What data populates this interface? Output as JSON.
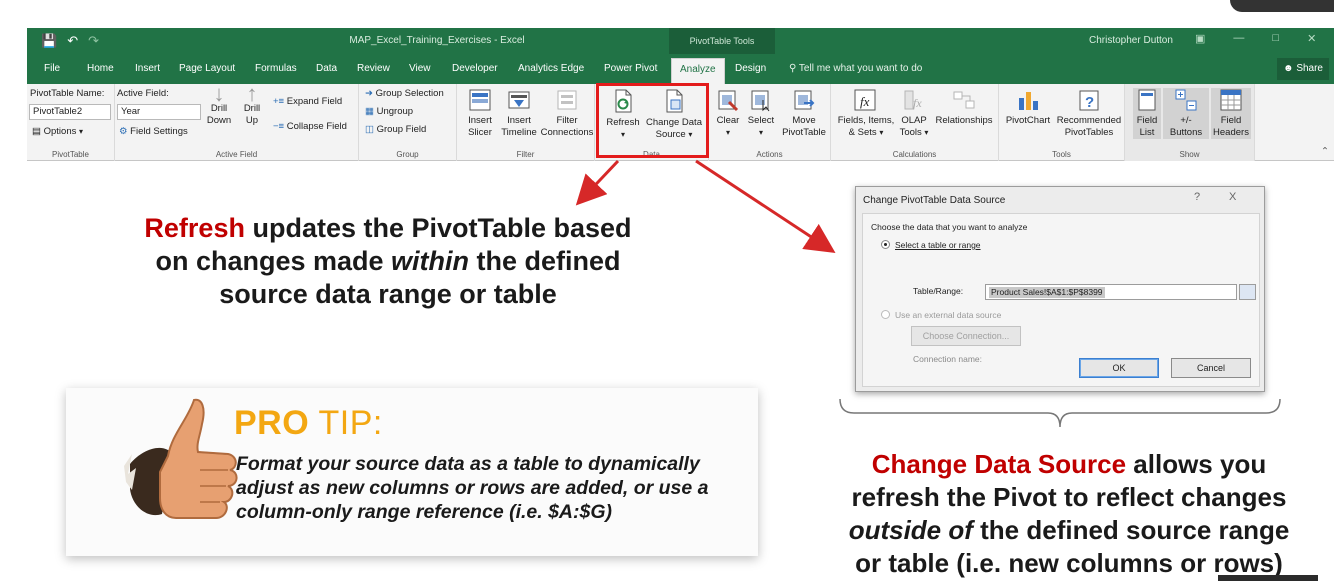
{
  "window": {
    "title": "MAP_Excel_Training_Exercises - Excel",
    "context_tools": "PivotTable Tools",
    "user": "Christopher Dutton"
  },
  "tabs": [
    "File",
    "Home",
    "Insert",
    "Page Layout",
    "Formulas",
    "Data",
    "Review",
    "View",
    "Developer",
    "Analytics Edge",
    "Power Pivot",
    "Analyze",
    "Design"
  ],
  "active_tab": "Analyze",
  "tell_me": "Tell me what you want to do",
  "share": "Share",
  "ribbon": {
    "pivottable": {
      "name_label": "PivotTable Name:",
      "name_value": "PivotTable2",
      "options": "Options",
      "group": "PivotTable"
    },
    "active_field": {
      "label": "Active Field:",
      "value": "Year",
      "field_settings": "Field Settings",
      "drill_down": [
        "Drill",
        "Down"
      ],
      "drill_up": [
        "Drill",
        "Up"
      ],
      "expand": "Expand Field",
      "collapse": "Collapse Field",
      "group": "Active Field"
    },
    "group_grp": {
      "group_selection": "Group Selection",
      "ungroup": "Ungroup",
      "group_field": "Group Field",
      "group": "Group"
    },
    "filter": {
      "insert_slicer": [
        "Insert",
        "Slicer"
      ],
      "insert_timeline": [
        "Insert",
        "Timeline"
      ],
      "filter_connections": [
        "Filter",
        "Connections"
      ],
      "group": "Filter"
    },
    "data": {
      "refresh": "Refresh",
      "change_source": [
        "Change Data",
        "Source"
      ],
      "group": "Data"
    },
    "actions": {
      "clear": "Clear",
      "select": "Select",
      "move": [
        "Move",
        "PivotTable"
      ],
      "group": "Actions"
    },
    "calculations": {
      "fields_items": [
        "Fields, Items,",
        "& Sets"
      ],
      "olap": [
        "OLAP",
        "Tools"
      ],
      "relationships": "Relationships",
      "group": "Calculations"
    },
    "tools": {
      "pivotchart": "PivotChart",
      "recommended": [
        "Recommended",
        "PivotTables"
      ],
      "group": "Tools"
    },
    "show": {
      "field_list": [
        "Field",
        "List"
      ],
      "buttons": [
        "+/-",
        "Buttons"
      ],
      "headers": [
        "Field",
        "Headers"
      ],
      "group": "Show"
    }
  },
  "refresh_note": {
    "keyword": "Refresh",
    "line1_rest": " updates the PivotTable based",
    "line2_a": "on changes made ",
    "line2_em": "within",
    "line2_b": " the defined",
    "line3": "source data range or table"
  },
  "pro_tip": {
    "pro": "PRO",
    "tip": " TIP:",
    "body": "Format your source data as a table to dynamically adjust as new columns or rows are added, or use a column-only range reference (i.e. $A:$G)"
  },
  "dialog": {
    "title": "Change PivotTable Data Source",
    "help": "?",
    "close": "X",
    "choose_label": "Choose the data that you want to analyze",
    "option_table": "Select a table or range",
    "table_range_label": "Table/Range:",
    "table_range_value": "Product Sales!$A$1:$P$8399",
    "option_external": "Use an external data source",
    "choose_connection": "Choose Connection...",
    "connection_name": "Connection name:",
    "ok": "OK",
    "cancel": "Cancel"
  },
  "change_note": {
    "keyword": "Change Data Source",
    "line1_rest": " allows you",
    "line2": "refresh the Pivot to reflect changes",
    "line3_em": "outside of",
    "line3_rest": " the defined source range",
    "line4": "or table (i.e. new columns or rows)"
  },
  "colors": {
    "excel_green": "#217346",
    "highlight_red": "#e31b1b",
    "keyword_red": "#c00000",
    "pro_orange": "#f3a712"
  }
}
